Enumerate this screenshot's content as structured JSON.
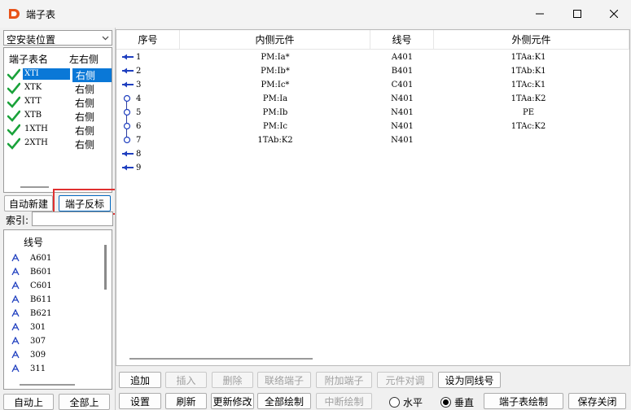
{
  "window": {
    "title": "端子表",
    "app_icon": "app-logo-icon",
    "controls": [
      "minimize-icon",
      "maximize-icon",
      "close-icon"
    ]
  },
  "left": {
    "location_select": {
      "value": "空安装位置"
    },
    "terminal_table": {
      "headers": [
        "端子表名",
        "左右侧"
      ],
      "rows": [
        {
          "name": "XTI",
          "side": "右侧",
          "selected": true
        },
        {
          "name": "XTK",
          "side": "右侧"
        },
        {
          "name": "XTT",
          "side": "右侧"
        },
        {
          "name": "XTB",
          "side": "右侧"
        },
        {
          "name": "1XTH",
          "side": "右侧"
        },
        {
          "name": "2XTH",
          "side": "右侧"
        }
      ]
    },
    "auto_new_label": "自动新建",
    "reverse_label": "端子反标",
    "search_label": "索引:",
    "search_value": "",
    "wire_list": {
      "header": "线号",
      "items": [
        "A601",
        "B601",
        "C601",
        "B611",
        "B621",
        "301",
        "307",
        "309",
        "311"
      ]
    },
    "auto_up_label": "自动上",
    "all_up_label": "全部上"
  },
  "grid": {
    "headers": [
      "序号",
      "内侧元件",
      "线号",
      "外侧元件"
    ],
    "rows": [
      {
        "seq": "1",
        "inner": "PM:Ia*",
        "wire": "A401",
        "outer": "1TAa:K1",
        "symbol": "arrow"
      },
      {
        "seq": "2",
        "inner": "PM:Ib*",
        "wire": "B401",
        "outer": "1TAb:K1",
        "symbol": "arrow"
      },
      {
        "seq": "3",
        "inner": "PM:Ic*",
        "wire": "C401",
        "outer": "1TAc:K1",
        "symbol": "arrow"
      },
      {
        "seq": "4",
        "inner": "PM:Ia",
        "wire": "N401",
        "outer": "1TAa:K2",
        "symbol": "circle"
      },
      {
        "seq": "5",
        "inner": "PM:Ib",
        "wire": "N401",
        "outer": "PE",
        "symbol": "circle"
      },
      {
        "seq": "6",
        "inner": "PM:Ic",
        "wire": "N401",
        "outer": "1TAc:K2",
        "symbol": "circle"
      },
      {
        "seq": "7",
        "inner": "1TAb:K2",
        "wire": "N401",
        "outer": "",
        "symbol": "circle"
      },
      {
        "seq": "8",
        "inner": "",
        "wire": "",
        "outer": "",
        "symbol": "arrow"
      },
      {
        "seq": "9",
        "inner": "",
        "wire": "",
        "outer": "",
        "symbol": "arrow"
      }
    ]
  },
  "toolbar_row1": {
    "append": "追加",
    "insert": "插入",
    "delete": "删除",
    "link": "联络端子",
    "attach": "附加端子",
    "swap": "元件对调",
    "same_wire": "设为同线号"
  },
  "toolbar_row2": {
    "settings": "设置",
    "refresh": "刷新",
    "update": "更新修改",
    "draw_all": "全部绘制",
    "break_draw": "中断绘制",
    "horizontal": "水平",
    "vertical": "垂直",
    "orientation_selected": "垂直",
    "table_draw": "端子表绘制",
    "save_close": "保存关闭"
  },
  "colors": {
    "selection": "#0a78d7",
    "connector": "#1f3fbf",
    "highlight_box": "#e03030"
  }
}
